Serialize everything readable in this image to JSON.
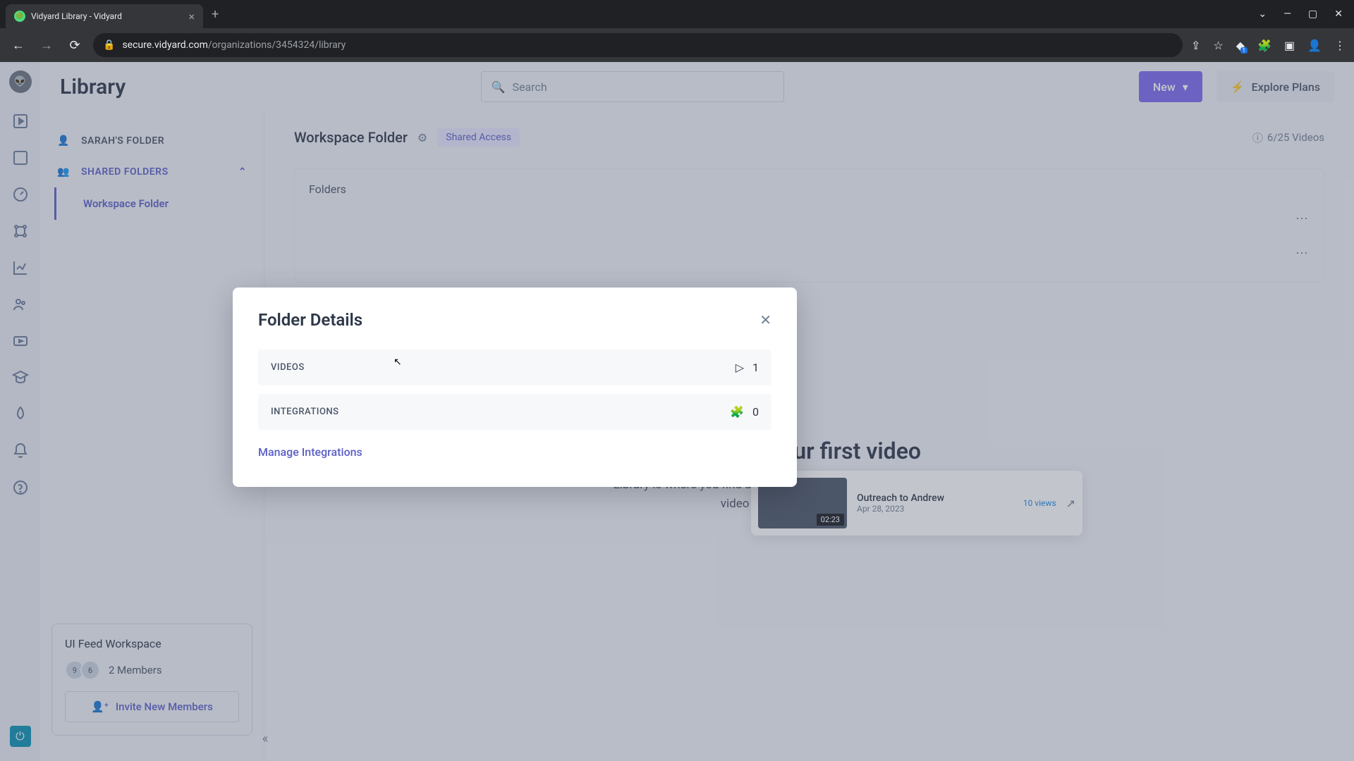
{
  "browser": {
    "tab_title": "Vidyard Library - Vidyard",
    "url_domain": "secure.vidyard.com",
    "url_path": "/organizations/3454324/library",
    "ext_badge": "1"
  },
  "header": {
    "title": "Library",
    "search_placeholder": "Search",
    "new_button": "New",
    "explore_button": "Explore Plans"
  },
  "sidebar": {
    "personal_folder": "SARAH'S FOLDER",
    "shared_label": "SHARED FOLDERS",
    "sub_item": "Workspace Folder",
    "workspace": {
      "name": "UI Feed Workspace",
      "av1": "9",
      "av2": "6",
      "members": "2 Members",
      "invite": "Invite New Members"
    }
  },
  "content": {
    "folder_title": "Workspace Folder",
    "shared_badge": "Shared Access",
    "video_count": "6/25 Videos",
    "folders_label": "Folders",
    "video": {
      "title": "Outreach to Andrew",
      "date": "Apr 28, 2023",
      "views": "10 views",
      "duration": "02:23"
    },
    "empty_title": "Create your first video",
    "empty_desc": "Library is where you find all your videos. Get started by recording your first video or drag and drop a file here."
  },
  "modal": {
    "title": "Folder Details",
    "videos_label": "VIDEOS",
    "videos_count": "1",
    "integrations_label": "INTEGRATIONS",
    "integrations_count": "0",
    "manage_link": "Manage Integrations"
  }
}
